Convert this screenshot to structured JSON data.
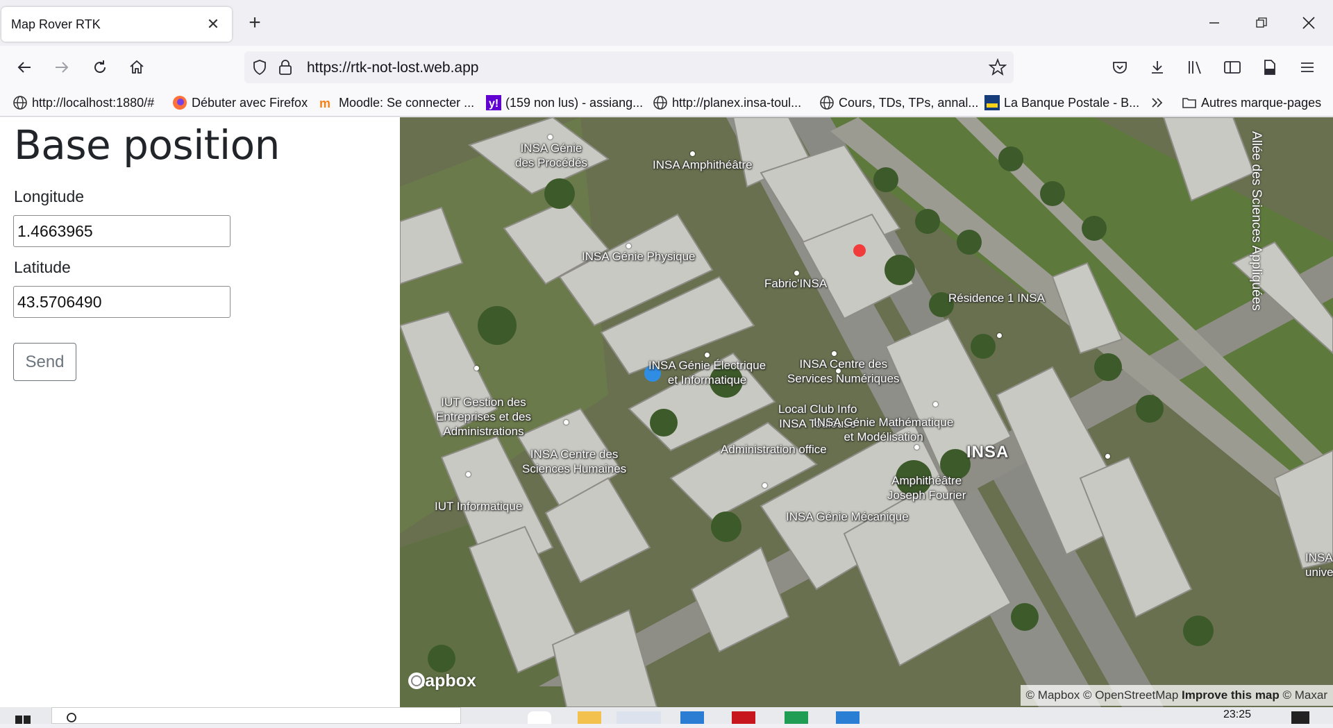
{
  "browser": {
    "tab_title": "Map Rover RTK",
    "url": "https://rtk-not-lost.web.app",
    "bookmarks": [
      "http://localhost:1880/#",
      "Débuter avec Firefox",
      "Moodle: Se connecter ...",
      "(159 non lus) - assiang...",
      "http://planex.insa-toul...",
      "Cours, TDs, TPs, annal...",
      "La Banque Postale - B...",
      "Autres marque-pages"
    ]
  },
  "form": {
    "title": "Base position",
    "longitude_label": "Longitude",
    "longitude_value": "1.4663965",
    "latitude_label": "Latitude",
    "latitude_value": "43.5706490",
    "send_label": "Send"
  },
  "map": {
    "labels": {
      "genie_procedes": "INSA Génie\ndes Procédés",
      "amphitheatre": "INSA Amphithéâtre",
      "genie_physique": "INSA Génie Physique",
      "fabric": "Fabric'INSA",
      "residence": "Résidence 1 INSA",
      "allee": "Allée des Sciences Appliquées",
      "centre_services": "INSA Centre des\nServices Numériques",
      "genie_electrique": "INSA Génie Électrique\net Informatique",
      "iut_gestion": "IUT Gestion des\nEntreprises et des\nAdministrations",
      "local_club": "Local Club Info\nINSA Toulouse",
      "genie_math": "INSA Génie Mathématique\net Modélisation",
      "administration": "Administration office",
      "insa": "INSA",
      "centre_sciences": "INSA Centre des\nSciences Humaines",
      "amphi_fourier": "Amphithéâtre\nJoseph Fourier",
      "iut_info": "IUT Informatique",
      "genie_meca": "INSA Génie Mécanique",
      "resto": "INSA rest\nuniversi"
    },
    "logo": "mapbox",
    "attribution": {
      "mapbox": "© Mapbox",
      "osm": "© OpenStreetMap",
      "improve": "Improve this map",
      "maxar": "© Maxar"
    }
  },
  "taskbar": {
    "time": "23:25"
  }
}
